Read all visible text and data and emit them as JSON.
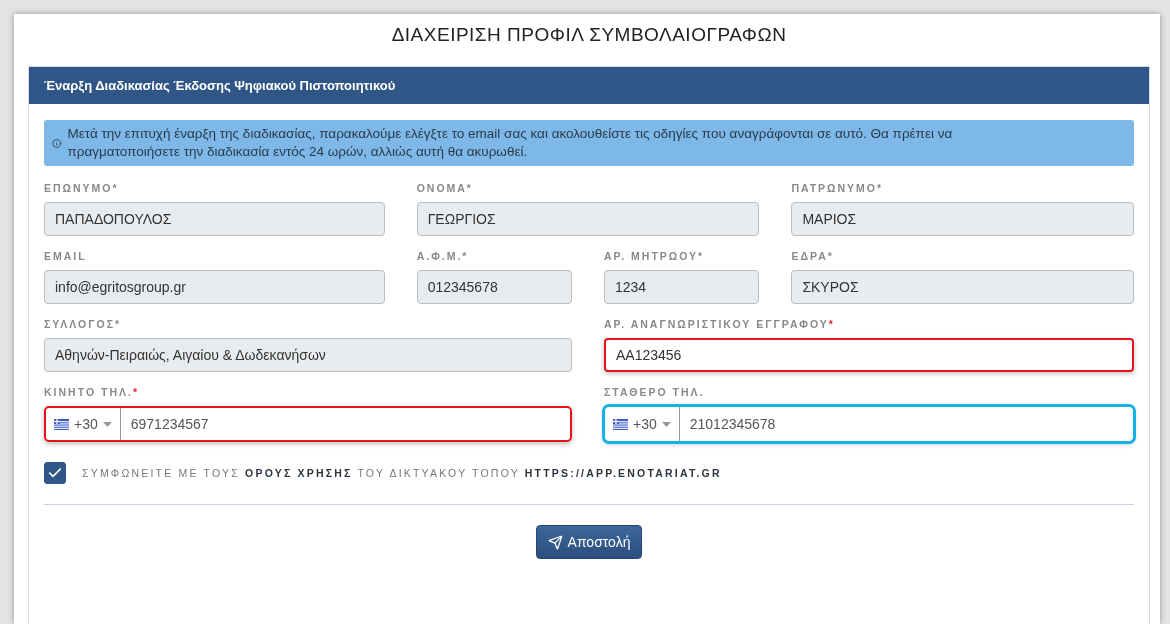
{
  "page_title": "ΔΙΑΧΕΙΡΙΣΗ ΠΡΟΦΙΛ ΣΥΜΒΟΛΑΙΟΓΡΑΦΩΝ",
  "card": {
    "title": "Έναρξη Διαδικασίας Έκδοσης Ψηφιακού Πιστοποιητικού",
    "info": "Μετά την επιτυχή έναρξη της διαδικασίας, παρακαλούμε ελέγξτε το email σας και ακολουθείστε τις οδηγίες που αναγράφονται σε αυτό. Θα πρέπει να πραγματοποιήσετε την διαδικασία εντός 24 ωρών, αλλιώς αυτή θα ακυρωθεί.",
    "fields": [
      {
        "kind": "text",
        "label": "ΕΠΩΝΥΜΟ*",
        "value": "ΠΑΠΑΔΟΠΟΥΛΟΣ",
        "readonly": true,
        "invalid": false,
        "focused": false
      },
      {
        "kind": "text",
        "label": "ΟΝΟΜΑ*",
        "value": "ΓΕΩΡΓΙΟΣ",
        "readonly": true,
        "invalid": false,
        "focused": false
      },
      {
        "kind": "text",
        "label": "ΠΑΤΡΩΝΥΜΟ*",
        "value": "ΜΑΡΙΟΣ",
        "readonly": true,
        "invalid": false,
        "focused": false
      },
      {
        "kind": "text",
        "label": "EMAIL",
        "value": "info@egritosgroup.gr",
        "readonly": true,
        "invalid": false,
        "focused": false
      },
      {
        "kind": "text",
        "label": "Α.Φ.Μ.*",
        "value": "012345678",
        "readonly": true,
        "invalid": false,
        "focused": false
      },
      {
        "kind": "text",
        "label": "ΑΡ. ΜΗΤΡΩΟΥ*",
        "value": "1234",
        "readonly": true,
        "invalid": false,
        "focused": false
      },
      {
        "kind": "text",
        "label": "ΕΔΡΑ*",
        "value": "ΣΚΥΡΟΣ",
        "readonly": true,
        "invalid": false,
        "focused": false
      },
      {
        "kind": "text",
        "label": "ΣΥΛΛΟΓΟΣ*",
        "value": "Αθηνών-Πειραιώς, Αιγαίου & Δωδεκανήσων",
        "readonly": true,
        "invalid": false,
        "focused": false
      },
      {
        "kind": "text",
        "label": "ΑΡ. ΑΝΑΓΝΩΡΙΣΤΙΚΟΥ ΕΓΓΡΑΦΟΥ",
        "required_mark": "*",
        "value": "ΑΑ123456",
        "readonly": false,
        "invalid": true,
        "focused": false
      },
      {
        "kind": "phone",
        "label": "ΚΙΝΗΤΟ ΤΗΛ.",
        "required_mark": "*",
        "dial_code": "+30",
        "value": "6971234567",
        "readonly": false,
        "invalid": true,
        "focused": false
      },
      {
        "kind": "phone",
        "label": "ΣΤΑΘΕΡΟ ΤΗΛ.",
        "dial_code": "+30",
        "value": "21012345678",
        "readonly": false,
        "invalid": false,
        "focused": true
      }
    ],
    "terms": {
      "checked": true,
      "text": "ΣΥΜΦΩΝΕΙΤΕ ΜΕ ΤΟΥΣ **ΟΡΟΥΣ ΧΡΗΣΗΣ** ΤΟΥ ΔΙΚΤΥΑΚΟΥ ΤΟΠΟΥ **HTTPS://APP.ENOTARIAT.GR**"
    },
    "submit": "Αποστολή"
  }
}
